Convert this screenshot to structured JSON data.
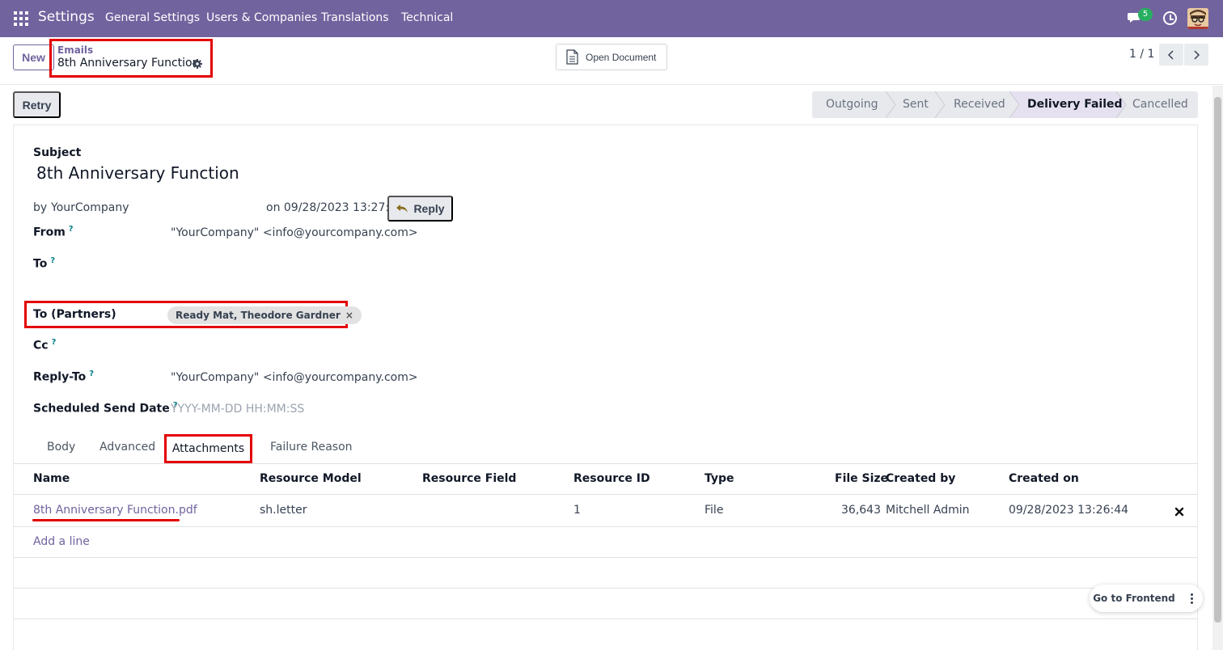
{
  "navbar": {
    "brand": "Settings",
    "menu": [
      "General Settings",
      "Users & Companies",
      "Translations",
      "Technical"
    ],
    "chat_count": "5"
  },
  "control_panel": {
    "new_label": "New",
    "breadcrumb_parent": "Emails",
    "breadcrumb_current": "8th Anniversary Function",
    "open_document_label": "Open Document",
    "pager": "1 / 1"
  },
  "statusbar": {
    "retry_label": "Retry",
    "stages": [
      "Outgoing",
      "Sent",
      "Received",
      "Delivery Failed",
      "Cancelled"
    ],
    "active_stage": "Delivery Failed"
  },
  "form": {
    "subject_label": "Subject",
    "subject": "8th Anniversary Function",
    "by_label": "by",
    "author": "YourCompany",
    "date_text": "on 09/28/2023 13:27:00",
    "reply_label": "Reply",
    "from_label": "From",
    "help_mark": "?",
    "from_value": "\"YourCompany\" <info@yourcompany.com>",
    "to_label": "To",
    "to_partners_label": "To (Partners)",
    "to_partners_tag": "Ready Mat, Theodore Gardner",
    "tag_remove": "×",
    "cc_label": "Cc",
    "reply_to_label": "Reply-To",
    "reply_to_value": "\"YourCompany\" <info@yourcompany.com>",
    "scheduled_label": "Scheduled Send Date",
    "scheduled_placeholder": "YYYY-MM-DD HH:MM:SS"
  },
  "tabs": [
    "Body",
    "Advanced",
    "Attachments",
    "Failure Reason"
  ],
  "active_tab": "Attachments",
  "attachments": {
    "columns": [
      "Name",
      "Resource Model",
      "Resource Field",
      "Resource ID",
      "Type",
      "File Size",
      "Created by",
      "Created on"
    ],
    "rows": [
      {
        "name": "8th Anniversary Function.pdf",
        "resource_model": "sh.letter",
        "resource_field": "",
        "resource_id": "1",
        "type": "File",
        "file_size": "36,643",
        "created_by": "Mitchell Admin",
        "created_on": "09/28/2023 13:26:44"
      }
    ],
    "add_line_label": "Add a line"
  },
  "frontend": {
    "go_to_frontend_label": "Go to Frontend"
  },
  "colors": {
    "brand": "#71639e",
    "highlight": "#e30000",
    "badge": "#27ae60"
  }
}
